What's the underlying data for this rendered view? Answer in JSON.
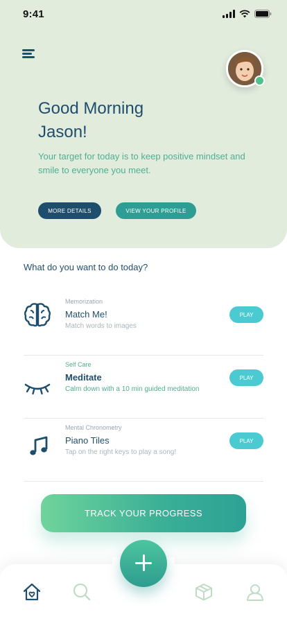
{
  "status_bar": {
    "time": "9:41"
  },
  "header": {
    "greeting_line1": "Good Morning",
    "greeting_line2": "Jason!",
    "subtext": "Your target for today is to keep positive mindset and smile to everyone you meet.",
    "more_details_label": "MORE DETAILS",
    "view_profile_label": "VIEW YOUR PROFILE"
  },
  "question": "What do you want to do today?",
  "activities": [
    {
      "category": "Memorization",
      "title": "Match Me!",
      "description": "Match words to images",
      "icon": "brain-icon",
      "play_label": "PLAY"
    },
    {
      "category": "Self Care",
      "title": "Meditate",
      "description": "Calm down with a 10 min guided meditation",
      "icon": "closed-eye-icon",
      "play_label": "PLAY"
    },
    {
      "category": "Mental Chronometry",
      "title": "Piano Tiles",
      "description": "Tap on the right keys to play a song!",
      "icon": "music-note-icon",
      "play_label": "PLAY"
    }
  ],
  "track_button_label": "TRACK YOUR PROGRESS",
  "bottom_nav": [
    "home-icon",
    "search-icon",
    "box-icon",
    "user-icon"
  ],
  "colors": {
    "navy": "#1f4e6d",
    "teal": "#4fae91",
    "hero_bg": "#e1ecdd",
    "play": "#4bcbd1"
  }
}
